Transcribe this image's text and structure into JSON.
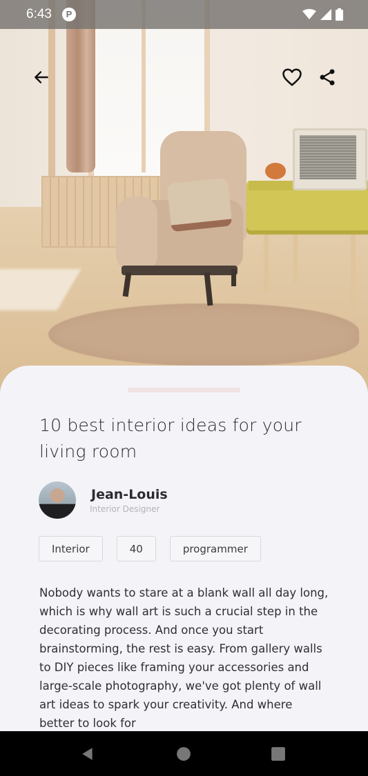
{
  "status_bar": {
    "time": "6:43",
    "app_icon_letter": "P",
    "icons": [
      "wifi-icon",
      "signal-icon",
      "battery-icon"
    ]
  },
  "toolbar": {
    "back_icon": "arrow-left-icon",
    "favorite_icon": "heart-outline-icon",
    "share_icon": "share-icon"
  },
  "article": {
    "title": "10 best interior ideas for your living room",
    "author": {
      "name": "Jean-Louis",
      "role": "Interior Designer"
    },
    "tags": [
      "Interior",
      "40",
      "programmer"
    ],
    "body": "Nobody wants to stare at a blank wall all day long, which is why wall art is such a crucial step in the decorating process. And once you start brainstorming, the rest is easy. From gallery walls to DIY pieces like framing your accessories and large-scale photography, we've got plenty of wall art ideas to spark your creativity. And where better to look for"
  },
  "nav_bar": {
    "icons": [
      "nav-back-icon",
      "nav-home-icon",
      "nav-recents-icon"
    ]
  },
  "colors": {
    "sheet_background": "#f4f4f8",
    "drag_handle": "#f1e2e4",
    "text_primary": "#2a2a2e",
    "text_secondary": "#b2b2b8",
    "tag_border": "#d8d8dc"
  }
}
